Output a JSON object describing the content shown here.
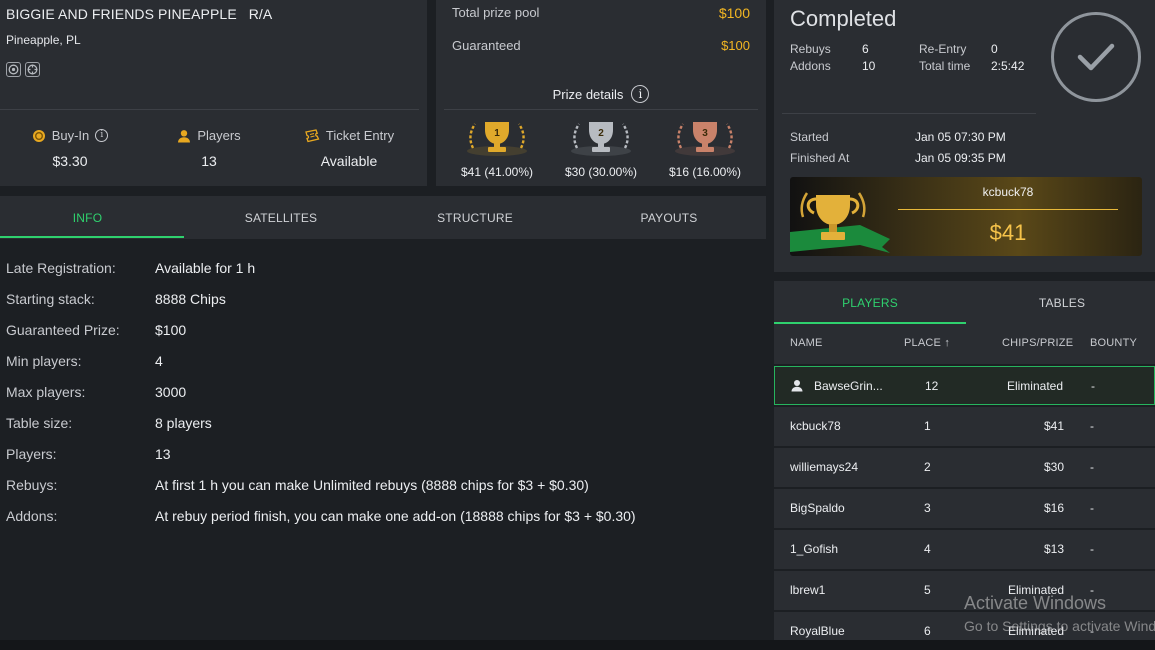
{
  "tournament": {
    "title": "BIGGIE AND FRIENDS PINEAPPLE   R/A",
    "game": "Pineapple, PL",
    "icons": [
      "chip-icon",
      "target-icon"
    ],
    "buyin": {
      "label": "Buy-In",
      "value": "$3.30"
    },
    "players": {
      "label": "Players",
      "value": "13"
    },
    "ticket": {
      "label": "Ticket Entry",
      "value": "Available"
    }
  },
  "prize": {
    "total_label": "Total prize pool",
    "total_value": "$100",
    "guaranteed_label": "Guaranteed",
    "guaranteed_value": "$100",
    "details_label": "Prize details",
    "places": [
      {
        "rank": "1",
        "value": "$41 (41.00%)",
        "color": "#e0a92b"
      },
      {
        "rank": "2",
        "value": "$30 (30.00%)",
        "color": "#b7bbc1"
      },
      {
        "rank": "3",
        "value": "$16 (16.00%)",
        "color": "#c9826a"
      }
    ]
  },
  "tabs": [
    "INFO",
    "SATELLITES",
    "STRUCTURE",
    "PAYOUTS"
  ],
  "info": [
    {
      "k": "Late Registration:",
      "v": "Available for 1 h"
    },
    {
      "k": "Starting stack:",
      "v": "8888 Chips"
    },
    {
      "k": "Guaranteed Prize:",
      "v": "$100"
    },
    {
      "k": "Min players:",
      "v": "4"
    },
    {
      "k": "Max players:",
      "v": "3000"
    },
    {
      "k": "Table size:",
      "v": "8 players"
    },
    {
      "k": "Players:",
      "v": "13"
    },
    {
      "k": "Rebuys:",
      "v": "At first 1 h you can make Unlimited rebuys (8888 chips for $3 + $0.30)"
    },
    {
      "k": "Addons:",
      "v": "At rebuy period finish, you can make one add-on (18888 chips for $3 + $0.30)"
    }
  ],
  "status": {
    "title": "Completed",
    "rebuys_label": "Rebuys",
    "rebuys_value": "6",
    "addons_label": "Addons",
    "addons_value": "10",
    "reentry_label": "Re-Entry",
    "reentry_value": "0",
    "totaltime_label": "Total time",
    "totaltime_value": "2:5:42",
    "started_label": "Started",
    "started_value": "Jan 05 07:30 PM",
    "finished_label": "Finished At",
    "finished_value": "Jan 05 09:35 PM",
    "winner_name": "kcbuck78",
    "winner_prize": "$41"
  },
  "player_tabs": [
    "PLAYERS",
    "TABLES"
  ],
  "table_headers": {
    "name": "NAME",
    "place": "PLACE ↑",
    "chips": "CHIPS/PRIZE",
    "bounty": "BOUNTY"
  },
  "players_list": [
    {
      "name": "BawseGrin...",
      "place": "12",
      "prize": "Eliminated",
      "bounty": "-",
      "me": true
    },
    {
      "name": "kcbuck78",
      "place": "1",
      "prize": "$41",
      "bounty": "-"
    },
    {
      "name": "williemays24",
      "place": "2",
      "prize": "$30",
      "bounty": "-"
    },
    {
      "name": "BigSpaldo",
      "place": "3",
      "prize": "$16",
      "bounty": "-"
    },
    {
      "name": "1_Gofish",
      "place": "4",
      "prize": "$13",
      "bounty": "-"
    },
    {
      "name": "lbrew1",
      "place": "5",
      "prize": "Eliminated",
      "bounty": "-"
    },
    {
      "name": "RoyalBlue",
      "place": "6",
      "prize": "Eliminated",
      "bounty": "-"
    }
  ],
  "watermark": {
    "line1": "Activate Windows",
    "line2": "Go to Settings to activate Windows."
  },
  "colors": {
    "accent": "#2fd16e",
    "gold": "#f2b623"
  }
}
